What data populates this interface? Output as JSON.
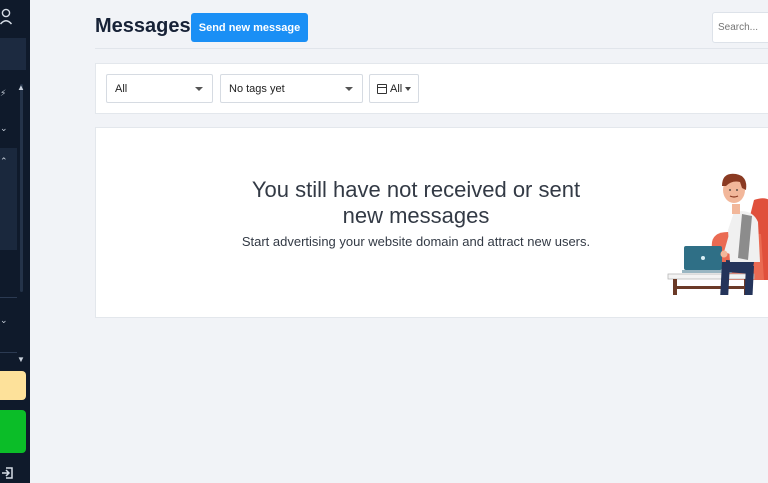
{
  "header": {
    "title": "Messages",
    "send_button_label": "Send new message",
    "search_placeholder": "Search..."
  },
  "filters": {
    "status_value": "All",
    "tags_value": "No tags yet",
    "date_value": "All"
  },
  "empty_state": {
    "title": "You still have not received or sent new messages",
    "subtitle": "Start advertising your website domain and attract new users."
  },
  "colors": {
    "sidebar": "#0f1a2b",
    "primary_button": "#1a8ff5",
    "highlight_yellow": "#fde19a",
    "highlight_green": "#0bbd28"
  },
  "icons": [
    "user-icon",
    "lightning-icon",
    "chevron-down-icon",
    "chevron-up-icon",
    "calendar-icon",
    "logout-icon"
  ]
}
